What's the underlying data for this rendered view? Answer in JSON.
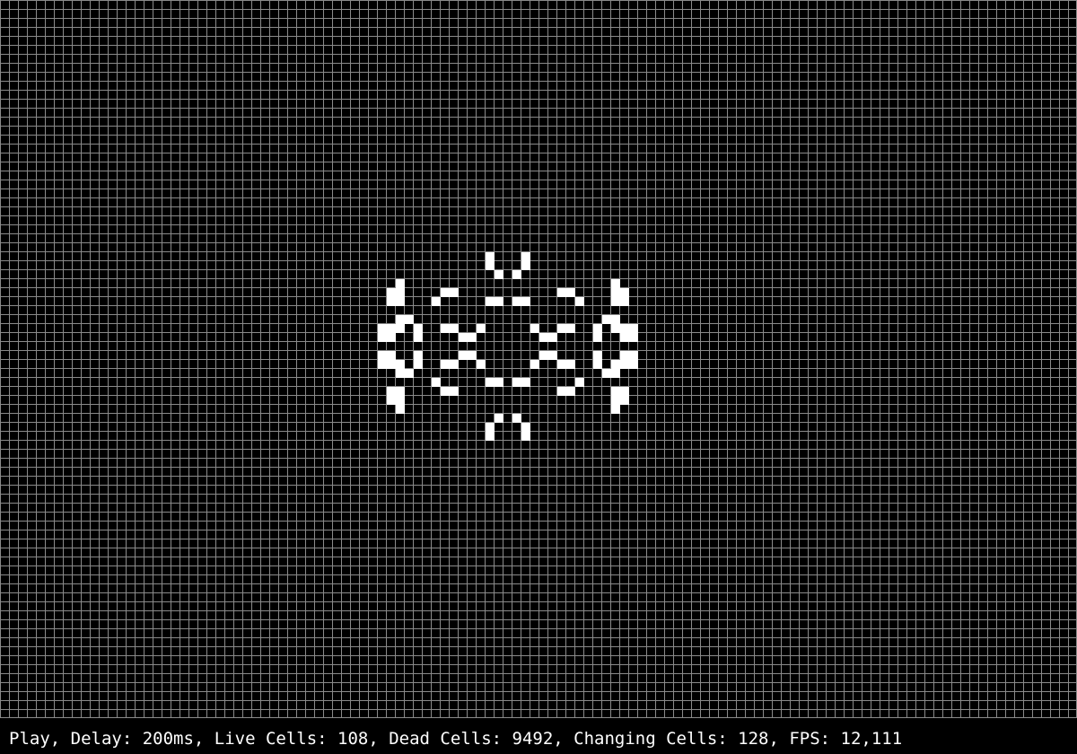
{
  "status": {
    "text": "Play, Delay: 200ms, Live Cells: 108, Dead Cells: 9492, Changing Cells: 128, FPS: 12,111"
  },
  "grid": {
    "columns": 120,
    "rows": 80,
    "grid_line_color": "#8a8a8a",
    "live_cell_color": "#ffffff",
    "background_color": "#000000",
    "live_cells": [
      [
        54,
        28
      ],
      [
        58,
        28
      ],
      [
        54,
        29
      ],
      [
        58,
        29
      ],
      [
        55,
        30
      ],
      [
        57,
        30
      ],
      [
        44,
        31
      ],
      [
        68,
        31
      ],
      [
        43,
        32
      ],
      [
        44,
        32
      ],
      [
        49,
        32
      ],
      [
        50,
        32
      ],
      [
        62,
        32
      ],
      [
        63,
        32
      ],
      [
        68,
        32
      ],
      [
        69,
        32
      ],
      [
        43,
        33
      ],
      [
        44,
        33
      ],
      [
        48,
        33
      ],
      [
        54,
        33
      ],
      [
        55,
        33
      ],
      [
        57,
        33
      ],
      [
        58,
        33
      ],
      [
        64,
        33
      ],
      [
        68,
        33
      ],
      [
        69,
        33
      ],
      [
        44,
        35
      ],
      [
        45,
        35
      ],
      [
        67,
        35
      ],
      [
        68,
        35
      ],
      [
        42,
        36
      ],
      [
        43,
        36
      ],
      [
        44,
        36
      ],
      [
        46,
        36
      ],
      [
        49,
        36
      ],
      [
        50,
        36
      ],
      [
        53,
        36
      ],
      [
        59,
        36
      ],
      [
        62,
        36
      ],
      [
        63,
        36
      ],
      [
        66,
        36
      ],
      [
        68,
        36
      ],
      [
        69,
        36
      ],
      [
        70,
        36
      ],
      [
        42,
        37
      ],
      [
        43,
        37
      ],
      [
        46,
        37
      ],
      [
        51,
        37
      ],
      [
        52,
        37
      ],
      [
        60,
        37
      ],
      [
        61,
        37
      ],
      [
        66,
        37
      ],
      [
        69,
        37
      ],
      [
        70,
        37
      ],
      [
        42,
        39
      ],
      [
        43,
        39
      ],
      [
        46,
        39
      ],
      [
        51,
        39
      ],
      [
        52,
        39
      ],
      [
        60,
        39
      ],
      [
        61,
        39
      ],
      [
        66,
        39
      ],
      [
        69,
        39
      ],
      [
        70,
        39
      ],
      [
        42,
        40
      ],
      [
        43,
        40
      ],
      [
        44,
        40
      ],
      [
        46,
        40
      ],
      [
        49,
        40
      ],
      [
        50,
        40
      ],
      [
        53,
        40
      ],
      [
        59,
        40
      ],
      [
        62,
        40
      ],
      [
        63,
        40
      ],
      [
        66,
        40
      ],
      [
        68,
        40
      ],
      [
        69,
        40
      ],
      [
        70,
        40
      ],
      [
        44,
        41
      ],
      [
        45,
        41
      ],
      [
        67,
        41
      ],
      [
        68,
        41
      ],
      [
        48,
        42
      ],
      [
        54,
        42
      ],
      [
        55,
        42
      ],
      [
        57,
        42
      ],
      [
        58,
        42
      ],
      [
        64,
        42
      ],
      [
        43,
        43
      ],
      [
        44,
        43
      ],
      [
        49,
        43
      ],
      [
        50,
        43
      ],
      [
        62,
        43
      ],
      [
        63,
        43
      ],
      [
        68,
        43
      ],
      [
        69,
        43
      ],
      [
        43,
        44
      ],
      [
        44,
        44
      ],
      [
        68,
        44
      ],
      [
        69,
        44
      ],
      [
        44,
        45
      ],
      [
        68,
        45
      ],
      [
        55,
        46
      ],
      [
        57,
        46
      ],
      [
        54,
        47
      ],
      [
        58,
        47
      ],
      [
        54,
        48
      ],
      [
        58,
        48
      ]
    ]
  }
}
